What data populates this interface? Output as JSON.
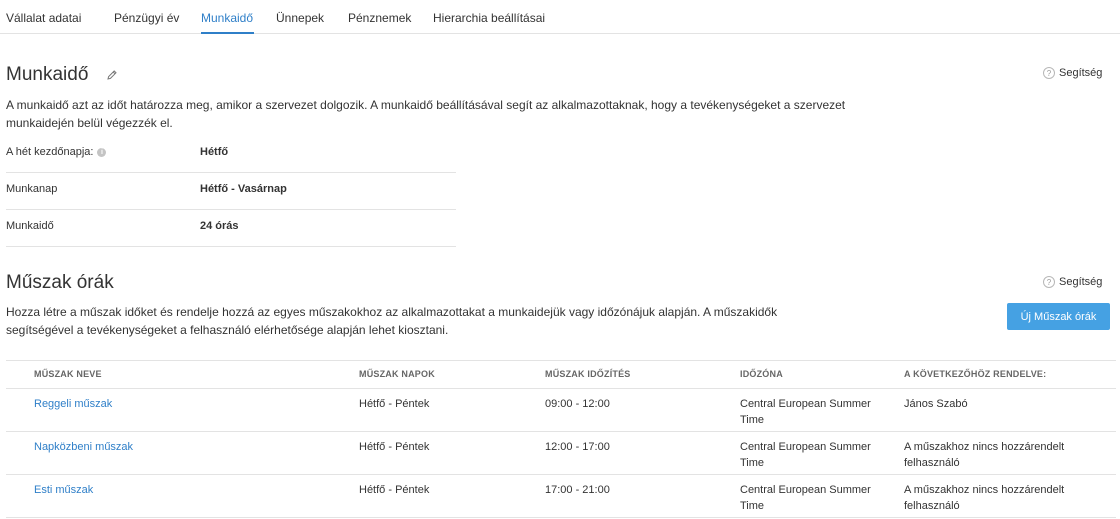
{
  "tabs": [
    {
      "label": "Vállalat adatai"
    },
    {
      "label": "Pénzügyi év"
    },
    {
      "label": "Munkaidő"
    },
    {
      "label": "Ünnepek"
    },
    {
      "label": "Pénznemek"
    },
    {
      "label": "Hierarchia beállításai"
    }
  ],
  "active_tab": "Munkaidő",
  "working_hours": {
    "title": "Munkaidő",
    "help": "Segítség",
    "description_line1": "A munkaidő azt az időt határozza meg, amikor a szervezet dolgozik. A munkaidő beállításával segít az alkalmazottaknak, hogy a tevékenységeket a szervezet",
    "description_line2": "munkaidején belül végezzék el.",
    "properties": [
      {
        "label": "A hét kezdőnapja:",
        "value": "Hétfő"
      },
      {
        "label": "Munkanap",
        "value": "Hétfő - Vasárnap"
      },
      {
        "label": "Munkaidő",
        "value": "24 órás"
      }
    ]
  },
  "shifts": {
    "title": "Műszak órák",
    "help": "Segítség",
    "description_line1": "Hozza létre a műszak időket és rendelje hozzá az egyes műszakokhoz az alkalmazottakat a munkaidejük vagy időzónájuk alapján. A műszakidők",
    "description_line2": "segítségével a tevékenységeket a felhasználó elérhetősége alapján lehet kiosztani.",
    "new_button": "Új Műszak órák",
    "columns": [
      "MŰSZAK NEVE",
      "MŰSZAK NAPOK",
      "MŰSZAK IDŐZÍTÉS",
      "IDŐZÓNA",
      "A KÖVETKEZŐHÖZ RENDELVE:"
    ],
    "rows": [
      {
        "name": "Reggeli műszak",
        "days": "Hétfő - Péntek",
        "timing": "09:00 - 12:00",
        "timezone": "Central European Summer Time",
        "assigned": "János Szabó"
      },
      {
        "name": "Napközbeni műszak",
        "days": "Hétfő - Péntek",
        "timing": "12:00 - 17:00",
        "timezone": "Central European Summer Time",
        "assigned": "A műszakhoz nincs hozzárendelt felhasználó"
      },
      {
        "name": "Esti műszak",
        "days": "Hétfő - Péntek",
        "timing": "17:00 - 21:00",
        "timezone": "Central European Summer Time",
        "assigned": "A műszakhoz nincs hozzárendelt felhasználó"
      }
    ]
  },
  "colors": {
    "accent": "#2f7fc8",
    "button": "#45a1e3",
    "border": "#e3e3e3"
  },
  "icons": [
    "pencil-icon",
    "help-icon",
    "info-icon"
  ]
}
